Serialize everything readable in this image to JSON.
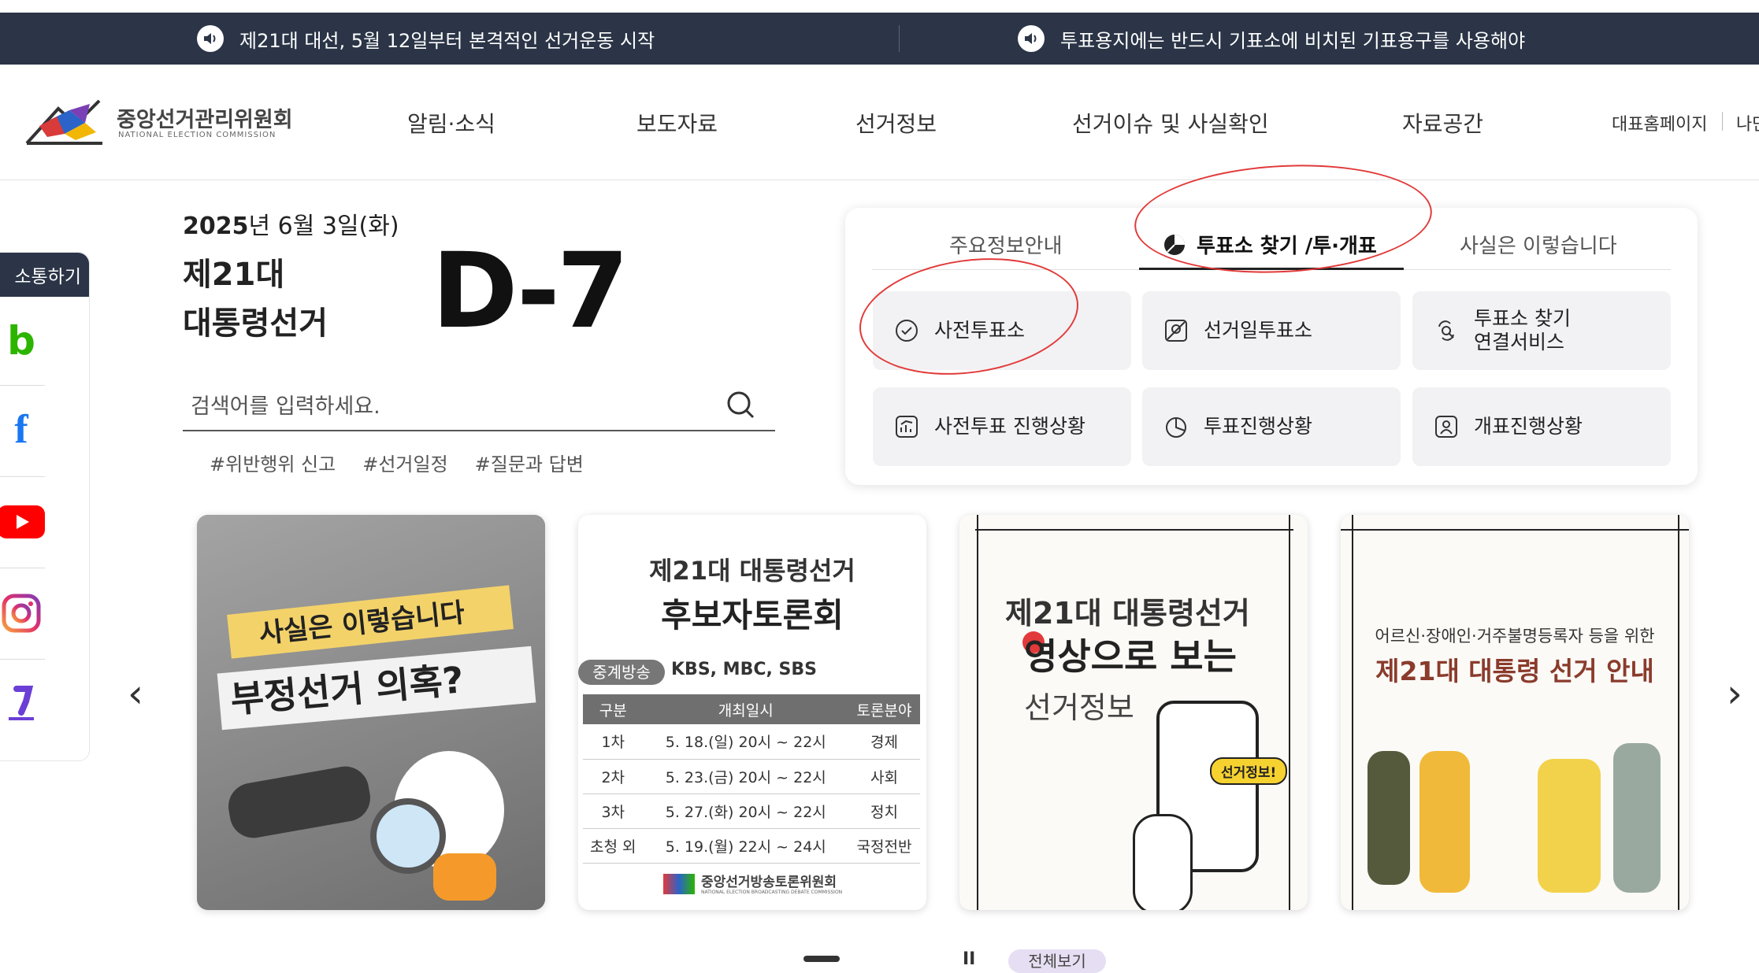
{
  "ticker": {
    "items": [
      {
        "icon": "speaker-icon",
        "text": "제21대 대선, 5월 12일부터 본격적인 선거운동 시작"
      },
      {
        "icon": "speaker-icon",
        "text": "투표용지에는 반드시 기표소에 비치된 기표용구를 사용해야"
      }
    ]
  },
  "header": {
    "logo": {
      "title": "중앙선거관리위원회",
      "subtitle": "NATIONAL ELECTION COMMISSION"
    },
    "nav": [
      "알림·소식",
      "보도자료",
      "선거정보",
      "선거이슈 및 사실확인",
      "자료공간"
    ],
    "util": [
      "대표홈페이지",
      "나만"
    ]
  },
  "sidebar": {
    "title": "소통하기",
    "icons": [
      "blog-icon",
      "facebook-icon",
      "youtube-icon",
      "instagram-icon",
      "kakao-story-icon"
    ],
    "blog_glyph": "b",
    "facebook_glyph": "f"
  },
  "election": {
    "date_bold": "2025",
    "date_rest": "년 6월 3일(화)",
    "title_line1": "제21대",
    "title_line2": "대통령선거",
    "dday": "D-7"
  },
  "search": {
    "placeholder": "검색어를 입력하세요.",
    "tags": [
      "#위반행위 신고",
      "#선거일정",
      "#질문과 답변"
    ]
  },
  "panel": {
    "tabs": [
      "주요정보안내",
      "투표소 찾기 /투·개표",
      "사실은 이렇습니다"
    ],
    "active_tab": 1,
    "buttons": [
      {
        "label": "사전투표소",
        "icon": "check-circle-icon"
      },
      {
        "label": "선거일투표소",
        "icon": "map-location-icon"
      },
      {
        "label": "투표소 찾기",
        "label2": "연결서비스",
        "icon": "link-search-icon"
      },
      {
        "label": "사전투표 진행상황",
        "icon": "chart-up-icon"
      },
      {
        "label": "투표진행상황",
        "icon": "pie-chart-icon"
      },
      {
        "label": "개표진행상황",
        "icon": "count-person-icon"
      }
    ]
  },
  "cards": {
    "card1": {
      "line1": "사실은 이렇습니다",
      "line2": "부정선거 의혹?"
    },
    "card2": {
      "title1": "제21대  대통령선거",
      "title2": "후보자토론회",
      "broadcast_badge": "중계방송",
      "broadcasters": "KBS, MBC, SBS",
      "table": {
        "headers": [
          "구분",
          "개최일시",
          "토론분야"
        ],
        "rows": [
          [
            "1차",
            "5. 18.(일) 20시 ~ 22시",
            "경제"
          ],
          [
            "2차",
            "5. 23.(금) 20시 ~ 22시",
            "사회"
          ],
          [
            "3차",
            "5. 27.(화) 20시 ~ 22시",
            "정치"
          ],
          [
            "초청 외",
            "5. 19.(월) 22시 ~ 24시",
            "국정전반"
          ]
        ]
      },
      "footer": "중앙선거방송토론위원회",
      "footer_sub": "NATIONAL ELECTION BROADCASTING DEBATE COMMISSION"
    },
    "card3": {
      "title": "제21대 대통령선거",
      "line2": "영상으로 보는",
      "line3": "선거정보",
      "bubble": "선거정보!"
    },
    "card4": {
      "subtitle": "어르신·장애인·거주불명등록자 등을 위한",
      "title": "제21대 대통령 선거 안내"
    }
  },
  "carousel": {
    "prev": "‹",
    "next": "›",
    "view_all": "전체보기",
    "pause": "II"
  },
  "colors": {
    "navy": "#2b3547",
    "annotation_red": "#e23a3a",
    "button_bg": "#f2f2f4"
  }
}
